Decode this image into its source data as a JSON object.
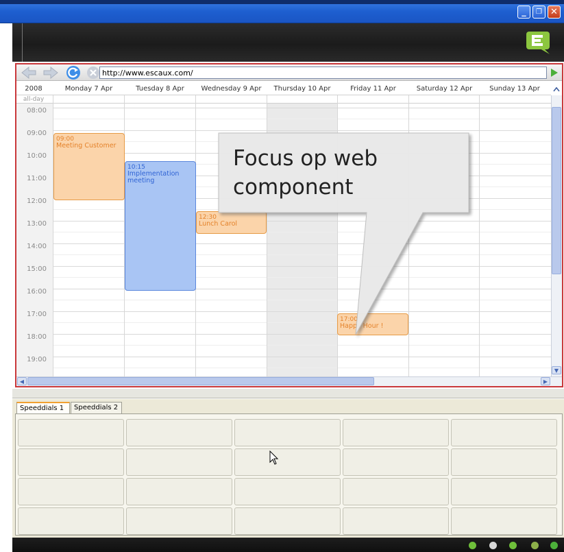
{
  "browser": {
    "url": "http://www.escaux.com/"
  },
  "calendar": {
    "year": "2008",
    "allday_label": "all-day",
    "days": [
      "Monday 7 Apr",
      "Tuesday 8 Apr",
      "Wednesday 9 Apr",
      "Thursday 10 Apr",
      "Friday 11 Apr",
      "Saturday 12 Apr",
      "Sunday 13 Apr"
    ],
    "hours": [
      "08:00",
      "09:00",
      "10:00",
      "11:00",
      "12:00",
      "13:00",
      "14:00",
      "15:00",
      "16:00",
      "17:00",
      "18:00",
      "19:00"
    ],
    "events": [
      {
        "time": "09:00",
        "title": "Meeting Customer",
        "color": "orange"
      },
      {
        "time": "10:15",
        "title": "Implementation meeting",
        "color": "blue"
      },
      {
        "time": "12:30",
        "title": "Lunch Carol",
        "color": "orange"
      },
      {
        "time": "17:00",
        "title": "Happy Hour !",
        "color": "orange"
      }
    ]
  },
  "speeddials": {
    "tabs": [
      "Speeddials 1",
      "Speeddials 2"
    ]
  },
  "callout": {
    "text": "Focus op web component"
  },
  "colors": {
    "title_blue": "#1e5fd0",
    "frame_red": "#c9373a",
    "event_orange": "#fbd4aa",
    "event_blue": "#a9c5f4",
    "logo_green": "#8cc63f"
  }
}
